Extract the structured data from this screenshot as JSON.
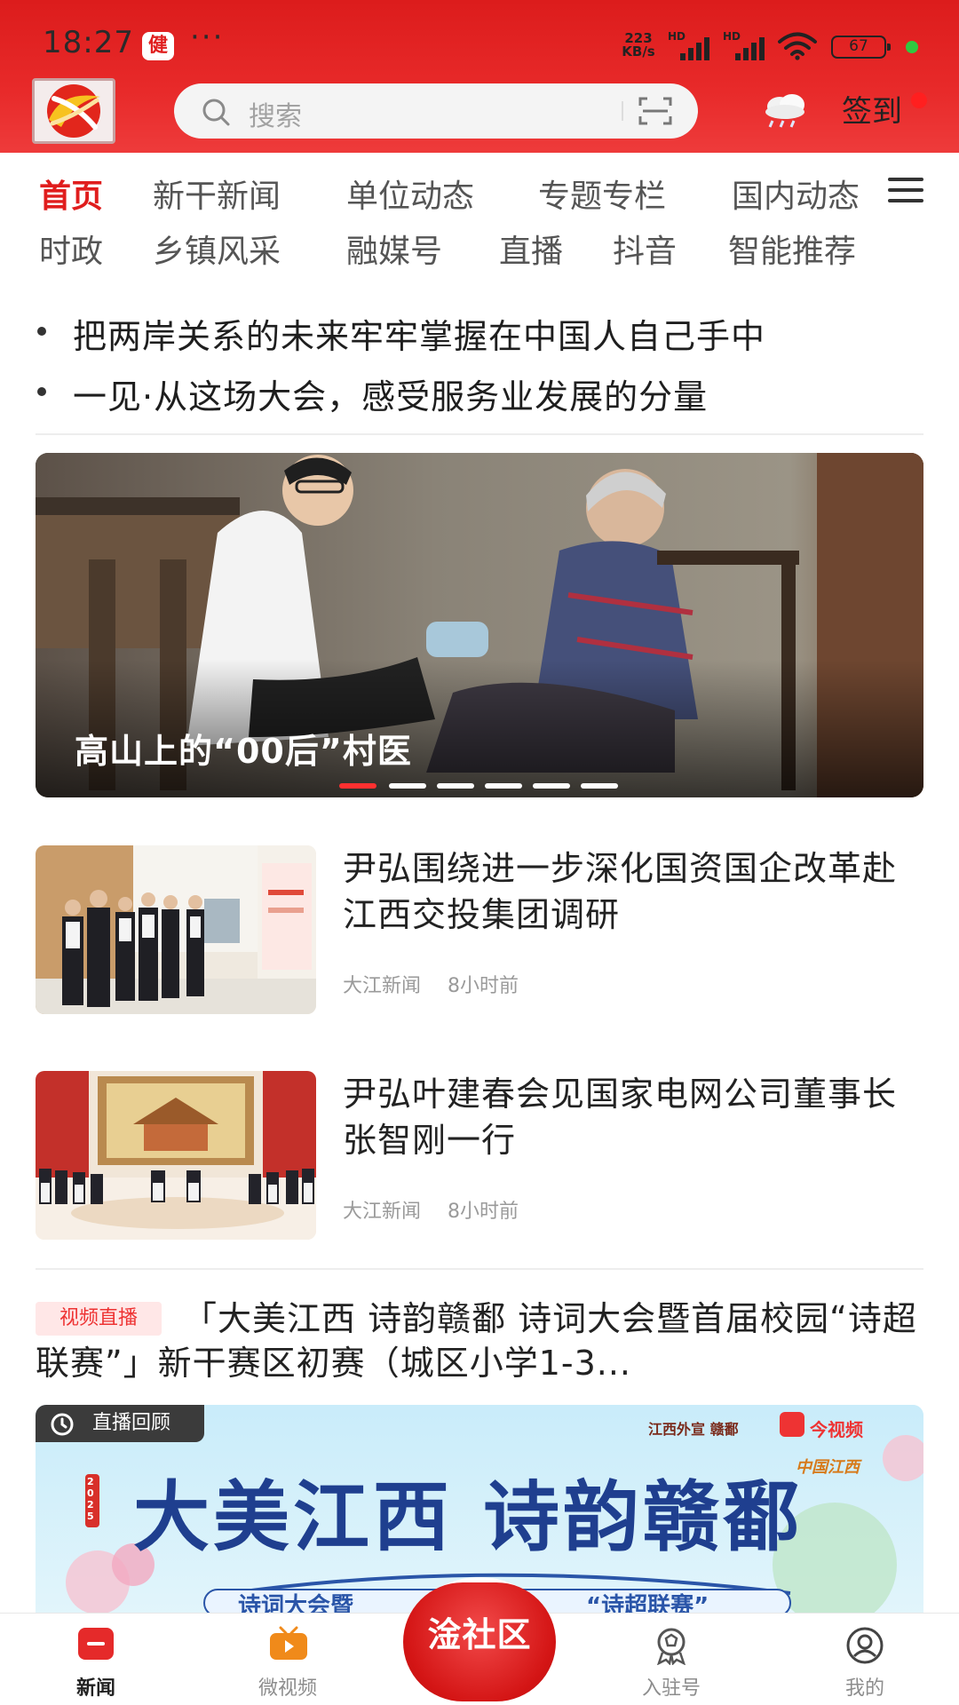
{
  "status_bar": {
    "time": "18:27",
    "health_badge": "健",
    "more_dots": "···",
    "net_speed_value": "223",
    "net_speed_unit": "KB/s",
    "sim1_label": "HD",
    "sim2_label": "HD",
    "battery": "67"
  },
  "header": {
    "search_placeholder": "搜索",
    "signin_label": "签到"
  },
  "nav": {
    "row1": [
      "首页",
      "新干新闻",
      "单位动态",
      "专题专栏",
      "国内动态"
    ],
    "row2": [
      "时政",
      "乡镇风采",
      "融媒号",
      "直播",
      "抖音",
      "智能推荐"
    ],
    "active": "首页"
  },
  "headlines": [
    "把两岸关系的未来牢牢掌握在中国人自己手中",
    "一见·从这场大会，感受服务业发展的分量"
  ],
  "banner": {
    "caption": "高山上的“00后”村医",
    "slide_count": 6,
    "active_slide": 1
  },
  "articles": [
    {
      "title": "尹弘围绕进一步深化国资国企改革赴江西交投集团调研",
      "source": "大江新闻",
      "time": "8小时前"
    },
    {
      "title": "尹弘叶建春会见国家电网公司董事长张智刚一行",
      "source": "大江新闻",
      "time": "8小时前"
    }
  ],
  "live_item": {
    "tag": "视频直播",
    "title": "「大美江西 诗韵赣鄱 诗词大会暨首届校园“诗超联赛”」新干赛区初赛（城区小学1-3...",
    "replay_label": "直播回顾",
    "poster_title": "大美江西 诗韵赣鄱",
    "poster_subtitle": "诗词大会暨",
    "poster_subtitle2": "“诗超联赛”",
    "poster_year": "2025",
    "poster_brand1": "江西外宣 赣鄱",
    "poster_brand2": "今视频",
    "poster_brand3": "中国江西"
  },
  "tabbar": {
    "items": [
      "新闻",
      "微视频",
      "入驻号",
      "我的"
    ],
    "center_label": "淦社区",
    "active": "新闻"
  },
  "colors": {
    "brand_red": "#e01d1d",
    "header_red": "#dc1c1c",
    "video_orange": "#f08a1a"
  }
}
